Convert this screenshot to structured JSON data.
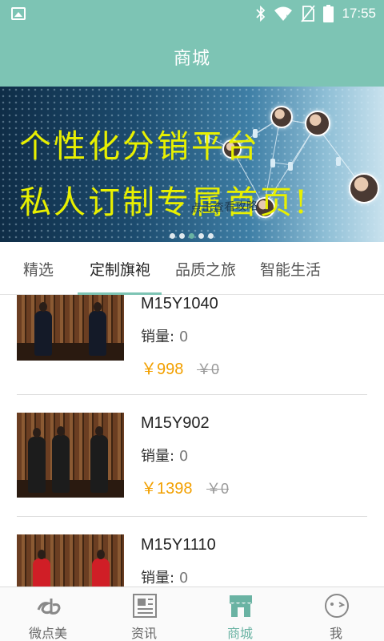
{
  "status_bar": {
    "time": "17:55"
  },
  "app_bar": {
    "title": "商城"
  },
  "banner": {
    "line1": "个性化分销平台",
    "line2": "私人订制专属首页!",
    "hint": "点击查看攻略"
  },
  "tabs": [
    {
      "label": "精选",
      "active": false
    },
    {
      "label": "定制旗袍",
      "active": true
    },
    {
      "label": "品质之旅",
      "active": false
    },
    {
      "label": "智能生活",
      "active": false
    }
  ],
  "products": [
    {
      "name": "M15Y1040",
      "sales_label": "销量:",
      "sales": "0",
      "price": "￥998",
      "old_price": "￥0",
      "dress_color": "#141a28"
    },
    {
      "name": "M15Y902",
      "sales_label": "销量:",
      "sales": "0",
      "price": "￥1398",
      "old_price": "￥0",
      "dress_color": "#1c1c1c"
    },
    {
      "name": "M15Y1110",
      "sales_label": "销量:",
      "sales": "0",
      "price": "",
      "old_price": "",
      "dress_color": "#d01e26"
    }
  ],
  "bottom_nav": [
    {
      "label": "微点美",
      "icon": "weidianmei-logo-icon",
      "active": false
    },
    {
      "label": "资讯",
      "icon": "newspaper-icon",
      "active": false
    },
    {
      "label": "商城",
      "icon": "shop-icon",
      "active": true
    },
    {
      "label": "我",
      "icon": "face-icon",
      "active": false
    }
  ],
  "colors": {
    "accent": "#7dc4b4",
    "price": "#f2a000",
    "active_nav": "#6ab3a3"
  }
}
